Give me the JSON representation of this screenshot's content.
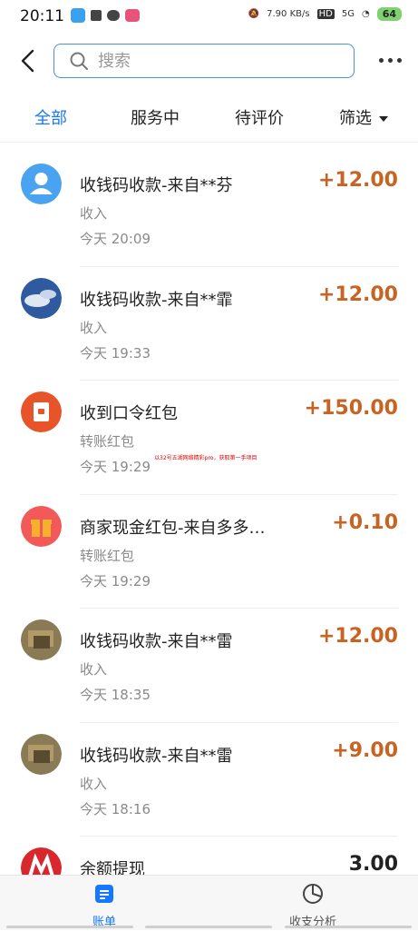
{
  "status_bar": {
    "time": "20:11",
    "network_speed": "7.90 KB/s",
    "hd": "HD",
    "signal": "5G",
    "battery": "64"
  },
  "header": {
    "search_placeholder": "搜索"
  },
  "tabs": [
    {
      "label": "全部",
      "active": true
    },
    {
      "label": "服务中",
      "active": false
    },
    {
      "label": "待评价",
      "active": false
    },
    {
      "label": "筛选",
      "active": false
    }
  ],
  "transactions": [
    {
      "title": "收钱码收款-来自**芬",
      "amount": "+12.00",
      "type": "收入",
      "time": "今天  20:09",
      "avatar": "default-user-icon"
    },
    {
      "title": "收钱码收款-来自**霏",
      "amount": "+12.00",
      "type": "收入",
      "time": "今天  19:33",
      "avatar": "sky-photo"
    },
    {
      "title": "收到口令红包",
      "amount": "+150.00",
      "type": "转账红包",
      "time": "今天  19:29",
      "avatar": "red-packet-icon"
    },
    {
      "title": "商家现金红包-来自多多…",
      "amount": "+0.10",
      "type": "转账红包",
      "time": "今天  19:29",
      "avatar": "gift-icon"
    },
    {
      "title": "收钱码收款-来自**雷",
      "amount": "+12.00",
      "type": "收入",
      "time": "今天  18:35",
      "avatar": "photo"
    },
    {
      "title": "收钱码收款-来自**雷",
      "amount": "+9.00",
      "type": "收入",
      "time": "今天  18:16",
      "avatar": "photo"
    },
    {
      "title": "余额提现",
      "amount": "3.00",
      "type": "",
      "time": "",
      "avatar": "bank-logo"
    }
  ],
  "watermark": "以32号五湖网络精彩pro，获取第一手项目",
  "bottom_nav": [
    {
      "label": "账单",
      "active": true
    },
    {
      "label": "收支分析",
      "active": false
    }
  ],
  "colors": {
    "accent": "#1677ff",
    "amount": "#c86423"
  }
}
